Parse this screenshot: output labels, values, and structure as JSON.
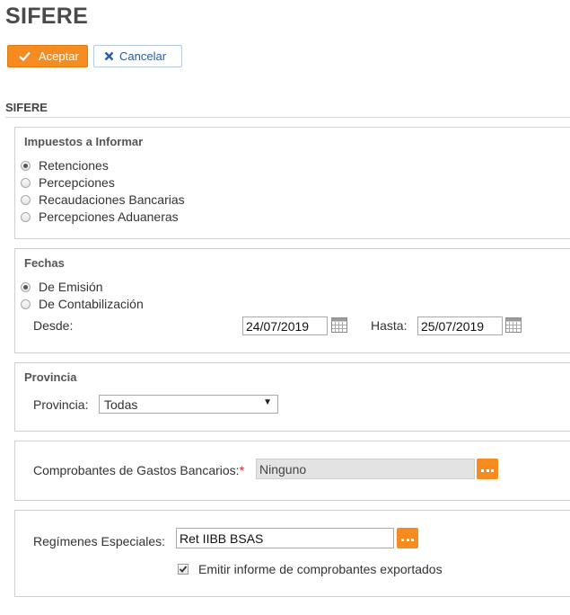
{
  "page": {
    "title": "SIFERE"
  },
  "toolbar": {
    "accept_label": "Aceptar",
    "cancel_label": "Cancelar"
  },
  "section": {
    "title": "SIFERE"
  },
  "taxes": {
    "legend": "Impuestos a Informar",
    "options": [
      "Retenciones",
      "Percepciones",
      "Recaudaciones Bancarias",
      "Percepciones Aduaneras"
    ],
    "selected": "Retenciones"
  },
  "dates": {
    "legend": "Fechas",
    "options": [
      "De Emisión",
      "De Contabilización"
    ],
    "selected": "De Emisión",
    "from_label": "Desde:",
    "from_value": "24/07/2019",
    "to_label": "Hasta:",
    "to_value": "25/07/2019"
  },
  "province": {
    "legend": "Provincia",
    "label": "Provincia:",
    "selected": "Todas"
  },
  "bank_expenses": {
    "label": "Comprobantes de Gastos Bancarios:",
    "required_mark": "*",
    "value": "Ninguno"
  },
  "special_regimes": {
    "label": "Regímenes Especiales:",
    "value": "Ret IIBB BSAS",
    "checkbox_label": "Emitir informe de comprobantes exportados",
    "checkbox_checked": true
  },
  "colors": {
    "accent": "#f68b1f",
    "link": "#2a5d9e"
  }
}
